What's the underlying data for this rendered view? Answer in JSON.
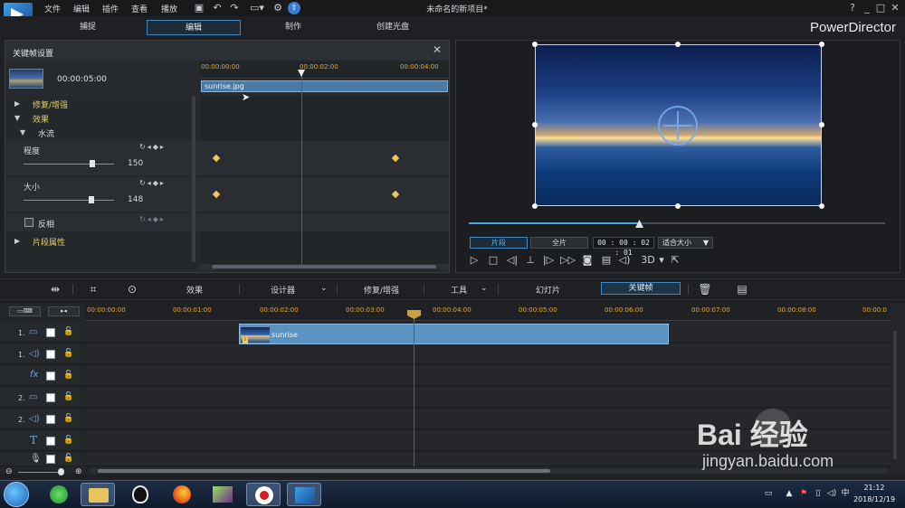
{
  "app": {
    "menu": [
      "文件",
      "编辑",
      "插件",
      "查看",
      "播放"
    ],
    "document_title": "未命名的新项目*",
    "brand": "PowerDirector",
    "window_controls": [
      "?",
      "_",
      "□",
      "✕"
    ]
  },
  "modes": [
    {
      "label": "捕捉",
      "active": false
    },
    {
      "label": "编辑",
      "active": true
    },
    {
      "label": "制作",
      "active": false
    },
    {
      "label": "创建光盘",
      "active": false
    }
  ],
  "keyframe_panel": {
    "title": "关键帧设置",
    "clip_duration": "00:00:05:00",
    "ruler_labels": [
      "00:00:00:00",
      "00:00:02:00",
      "00:00:04:00"
    ],
    "clip_name": "sunrise.jpg",
    "sections": {
      "fix_enhance": "修复/增强",
      "effects": "效果",
      "water": "水流",
      "degree": "程度",
      "degree_value": "150",
      "size": "大小",
      "size_value": "148",
      "invert": "反相",
      "clip_attributes": "片段属性"
    }
  },
  "preview": {
    "mode_clip": "片段",
    "mode_full": "全片",
    "timecode": "00 : 00 : 02 : 01",
    "fit": "适合大小",
    "three_d": "3D",
    "scrub_progress": 0.41
  },
  "toolbar": {
    "effects": "效果",
    "designer": "设计器",
    "fix_enhance": "修复/增强",
    "tools": "工具",
    "slideshow": "幻灯片",
    "keyframe": "关键帧"
  },
  "timeline": {
    "ruler_labels": [
      "00:00:00:00",
      "00:00:01:00",
      "00:00:02:00",
      "00:00:03:00",
      "00:00:04:00",
      "00:00:05:00",
      "00:00:06:00",
      "00:00:07:00",
      "00:00:08:00",
      "00:00:0"
    ],
    "tracks": [
      {
        "num": "1.",
        "type": "video"
      },
      {
        "num": "1.",
        "type": "audio"
      },
      {
        "num": "",
        "type": "fx"
      },
      {
        "num": "2.",
        "type": "video"
      },
      {
        "num": "2.",
        "type": "audio"
      },
      {
        "num": "",
        "type": "title"
      },
      {
        "num": "",
        "type": "voice"
      }
    ],
    "clip_label": "sunrise"
  },
  "taskbar": {
    "time": "21:12",
    "date": "2018/12/19"
  },
  "watermark": {
    "logo": "Bai  经验",
    "url": "jingyan.baidu.com"
  }
}
